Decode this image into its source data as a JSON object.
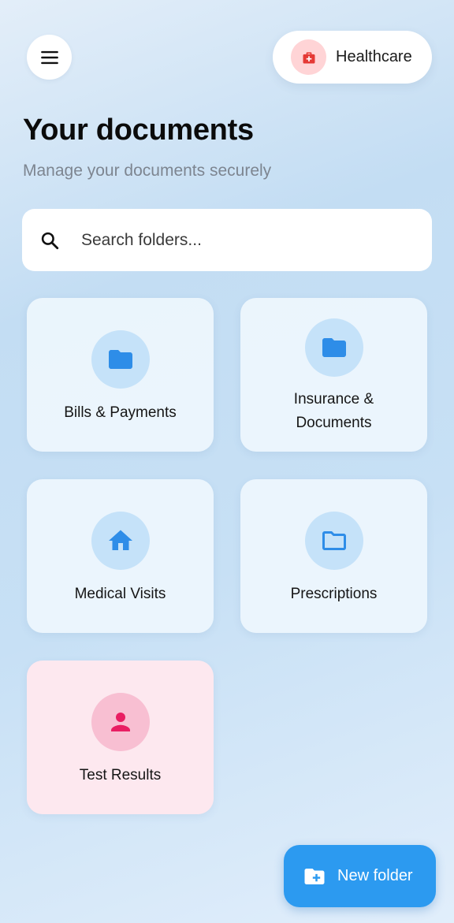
{
  "header": {
    "menu_icon": "hamburger-menu-icon",
    "category_chip": {
      "label": "Healthcare",
      "icon": "medical-kit-icon",
      "icon_color": "#e53935",
      "icon_bg": "#ffd4d6"
    }
  },
  "page": {
    "title": "Your documents",
    "subtitle": "Manage your documents securely"
  },
  "search": {
    "icon": "search-icon",
    "value": "",
    "placeholder": "Search folders..."
  },
  "folders": [
    {
      "label": "Bills & Payments",
      "icon": "folder-icon",
      "theme": "blue"
    },
    {
      "label": "Insurance & Documents",
      "icon": "folder-icon",
      "theme": "blue"
    },
    {
      "label": "Medical Visits",
      "icon": "home-icon",
      "theme": "blue"
    },
    {
      "label": "Prescriptions",
      "icon": "folder-outline-icon",
      "theme": "blue"
    },
    {
      "label": "Test Results",
      "icon": "person-icon",
      "theme": "pink"
    }
  ],
  "colors": {
    "accent": "#2c9af0",
    "folder_icon_blue": "#2e8de8",
    "folder_icon_pink": "#e91e63"
  },
  "fab": {
    "label": "New folder",
    "icon": "add-folder-icon"
  }
}
